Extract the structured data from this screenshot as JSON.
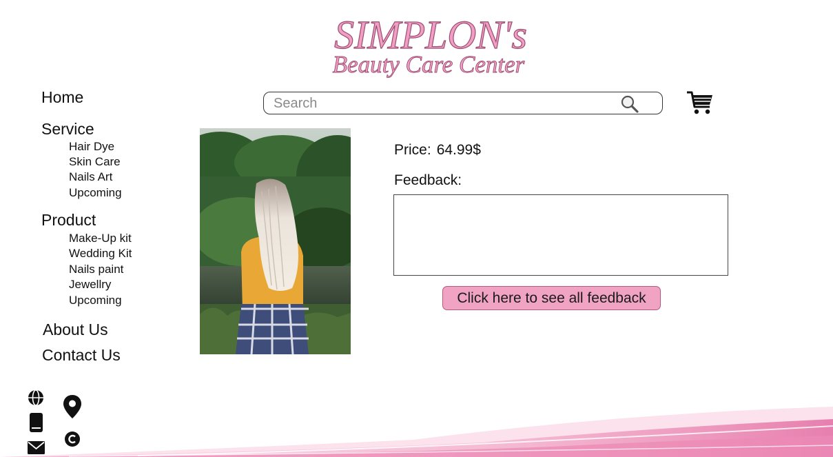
{
  "logo": {
    "line1": "SIMPLON's",
    "line2": "Beauty Care Center"
  },
  "nav": {
    "home": "Home",
    "service": {
      "label": "Service",
      "items": [
        "Hair Dye",
        "Skin Care",
        "Nails Art",
        "Upcoming"
      ]
    },
    "product": {
      "label": "Product",
      "items": [
        "Make-Up kit",
        "Wedding Kit",
        "Nails paint",
        "Jewellry",
        "Upcoming"
      ]
    },
    "about": "About Us",
    "contact": "Contact Us"
  },
  "search": {
    "placeholder": "Search"
  },
  "product": {
    "price_label": "Price:",
    "price_value": "64.99$",
    "feedback_label": "Feedback:",
    "feedback_button": "Click here to see all feedback"
  },
  "colors": {
    "accent_pink": "#f1a3c4",
    "logo_pink": "#ef9fc4",
    "logo_outline": "#9c4a70"
  },
  "icons": [
    "search-icon",
    "cart-icon",
    "globe-icon",
    "phone-icon",
    "mail-icon",
    "location-pin-icon",
    "copyright-icon"
  ]
}
